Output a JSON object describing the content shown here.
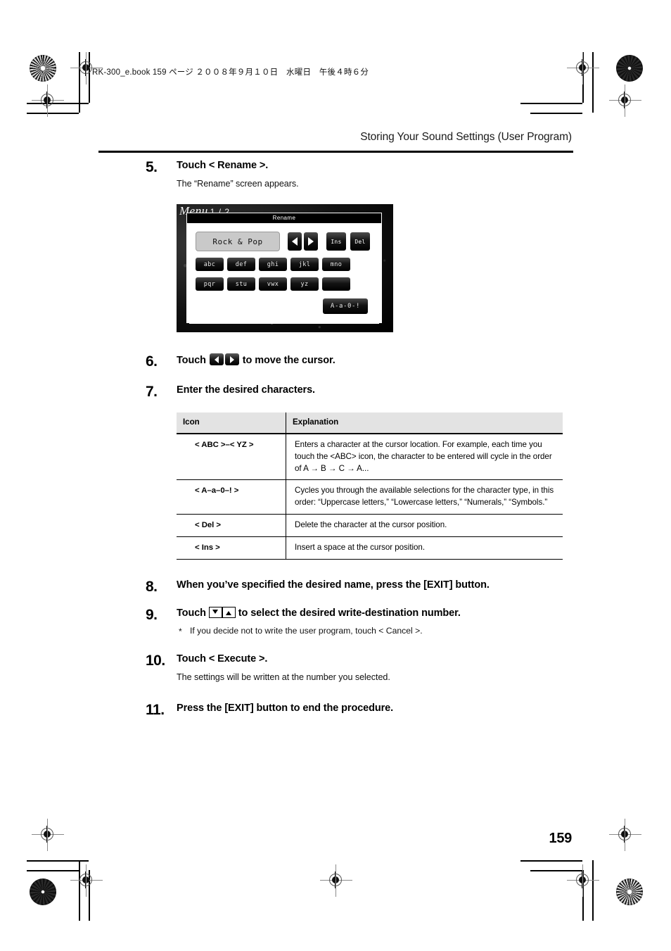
{
  "print_marks": {
    "slug_text": "RK-300_e.book  159 ページ  ２００８年９月１０日　水曜日　午後４時６分"
  },
  "running_head": {
    "title": "Storing Your Sound Settings (User Program)"
  },
  "page_number": "159",
  "steps": [
    {
      "number": "5.",
      "title": "Touch < Rename >.",
      "description": "The “Rename” screen appears."
    },
    {
      "number": "6.",
      "title_before": "Touch",
      "title_after": "to move the cursor."
    },
    {
      "number": "7.",
      "title": "Enter the desired characters."
    },
    {
      "number": "8.",
      "title": "When you’ve specified the desired name, press the [EXIT] button."
    },
    {
      "number": "9.",
      "title_before": "Touch",
      "title_after": "to select the desired write-destination number.",
      "note_marker": "*",
      "note": "If you decide not to write the user program, touch < Cancel >."
    },
    {
      "number": "10.",
      "title": "Touch < Execute >.",
      "description": "The settings will be written at the number you selected."
    },
    {
      "number": "11.",
      "title": "Press the [EXIT] button to end the procedure."
    }
  ],
  "lcd_screenshot": {
    "background_menu_label": "Menu",
    "background_menu_page": "1 / 2",
    "dialog_title": "Rename",
    "name_field_value": "Rock & Pop",
    "cursor_left_icon": "left-arrow-icon",
    "cursor_right_icon": "right-arrow-icon",
    "ins_label": "Ins",
    "del_label": "Del",
    "keys_row1": [
      "abc",
      "def",
      "ghi",
      "jkl",
      "mno"
    ],
    "keys_row2": [
      "pqr",
      "stu",
      "vwx",
      "yz",
      ""
    ],
    "charset_label": "A-a-0-!"
  },
  "icon_table": {
    "headers": [
      "Icon",
      "Explanation"
    ],
    "rows": [
      {
        "icon": "< ABC >–< YZ >",
        "explanation": "Enters a character at the cursor location. For example, each time you touch the <ABC> icon, the character to be entered will cycle in the order of A → B → C → A..."
      },
      {
        "icon": "< A–a–0–! >",
        "explanation": "Cycles you through the available selections for the character type, in this order: “Uppercase letters,” “Lowercase letters,” “Numerals,” “Symbols.”"
      },
      {
        "icon": "< Del >",
        "explanation": "Delete the character at the cursor position."
      },
      {
        "icon": "< Ins >",
        "explanation": "Insert a space at the cursor position."
      }
    ]
  }
}
